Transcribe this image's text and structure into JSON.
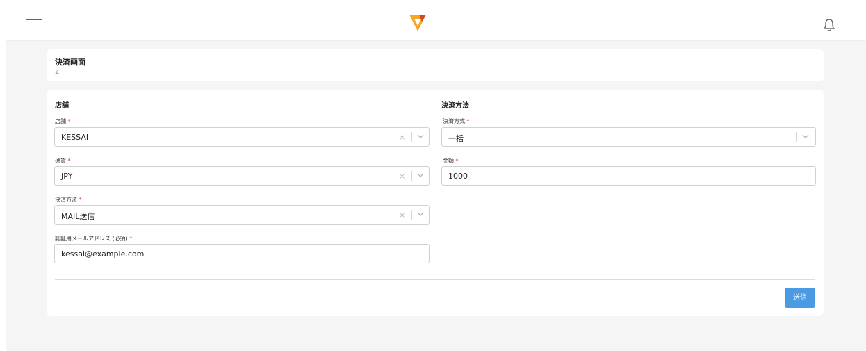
{
  "colors": {
    "accent": "#4a9be3",
    "required": "#e03131",
    "logo_primary": "#f5a623",
    "logo_dark": "#d6452a"
  },
  "icons": {
    "menu": "hamburger-icon",
    "logo": "v-logo",
    "bell": "bell-icon",
    "clear": "close-icon",
    "chevron": "chevron-down-icon"
  },
  "header": {
    "title": "決済画面",
    "subtitle": "#"
  },
  "store_section": {
    "title": "店舗",
    "store": {
      "label": "店舗",
      "required": "*",
      "value": "KESSAI",
      "clear": "×"
    },
    "currency": {
      "label": "通貨",
      "required": "*",
      "value": "JPY",
      "clear": "×"
    },
    "method": {
      "label": "決済方法",
      "required": "*",
      "value": "MAIL送信",
      "clear": "×"
    },
    "email": {
      "label": "認証用メールアドレス (必須)",
      "required": "*",
      "value": "kessai@example.com"
    }
  },
  "payment_section": {
    "title": "決済方法",
    "type": {
      "label": "決済方式",
      "required": "*",
      "value": "一括"
    },
    "amount": {
      "label": "金額",
      "required": "*",
      "value": "1000"
    }
  },
  "actions": {
    "submit_label": "送信"
  }
}
